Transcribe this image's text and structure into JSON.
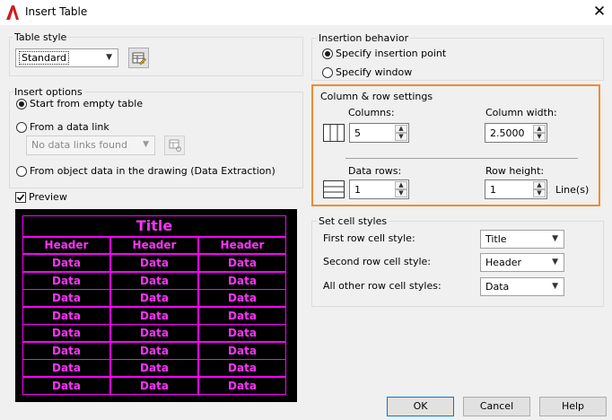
{
  "window": {
    "title": "Insert Table",
    "close_glyph": "✕"
  },
  "colors": {
    "accent": "#0078d7",
    "highlight": "#f28a2e",
    "preview_bg": "#000000",
    "preview_fg": "#ff00ff",
    "app_red": "#cc1f1f"
  },
  "table_style": {
    "label": "Table style",
    "value": "Standard",
    "launcher_icon": "table-style-dialog-icon"
  },
  "insert_options": {
    "label": "Insert options",
    "start_empty": "Start from empty table",
    "from_link": "From a data link",
    "link_value": "No data links found",
    "from_object": "From object data in the drawing (Data Extraction)"
  },
  "preview": {
    "label": "Preview",
    "checked": true,
    "title": "Title",
    "headers": [
      "Header",
      "Header",
      "Header"
    ],
    "data_label": "Data"
  },
  "insertion": {
    "label": "Insertion behavior",
    "specify_point": "Specify insertion point",
    "specify_window": "Specify window"
  },
  "col_row": {
    "label": "Column & row settings",
    "columns_label": "Columns:",
    "columns": "5",
    "col_width_label": "Column width:",
    "col_width": "2.5000",
    "data_rows_label": "Data rows:",
    "data_rows": "1",
    "row_height_label": "Row height:",
    "row_height": "1",
    "row_height_unit": "Line(s)"
  },
  "cell_styles": {
    "label": "Set cell styles",
    "first_label": "First row cell style:",
    "first_value": "Title",
    "second_label": "Second row cell style:",
    "second_value": "Header",
    "other_label": "All other row cell styles:",
    "other_value": "Data"
  },
  "buttons": {
    "ok": "OK",
    "cancel": "Cancel",
    "help": "Help"
  }
}
